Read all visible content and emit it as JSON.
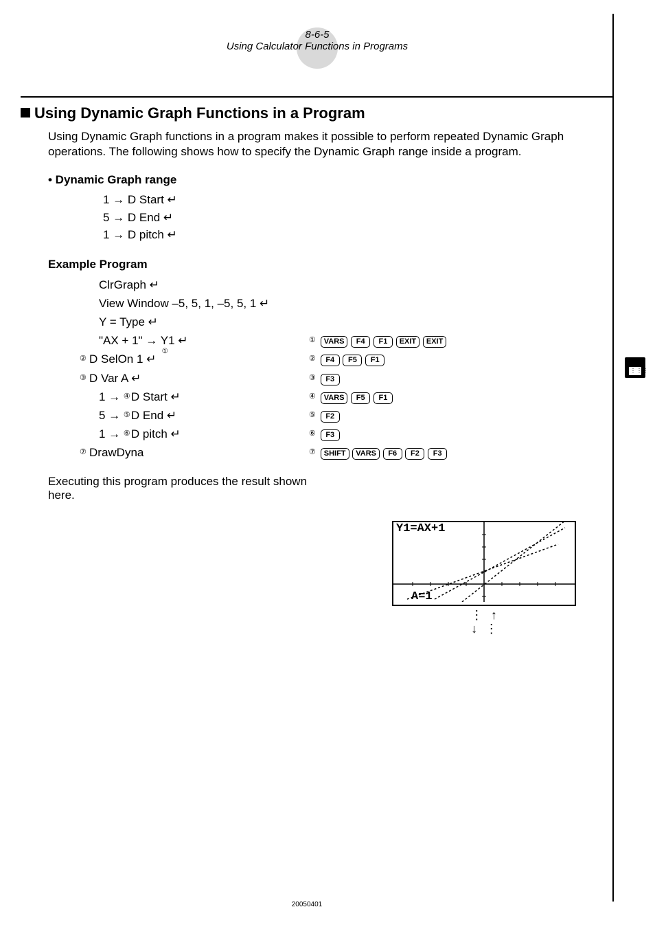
{
  "header": {
    "section": "8-6-5",
    "subtitle": "Using Calculator Functions in Programs"
  },
  "title": "Using Dynamic Graph Functions in a Program",
  "intro": "Using Dynamic Graph functions in a program makes it possible to perform repeated Dynamic Graph operations. The following shows how to specify the Dynamic Graph range inside a program.",
  "range_heading": "• Dynamic Graph range",
  "range_lines": [
    "1 → D  Start ↵",
    "5 → D  End ↵",
    "1 → D  pitch ↵"
  ],
  "example_heading": "Example Program",
  "example": {
    "l1": "ClrGraph ↵",
    "l2": "View Window  –5, 5, 1, –5, 5, 1 ↵",
    "l3": "Y = Type ↵",
    "l4": "\"AX + 1\" → Y1 ↵",
    "l5": "D SelOn 1 ↵",
    "l6": "D Var A ↵",
    "l7": "1 → ",
    "l7b": "D  Start ↵",
    "l8": "5 → ",
    "l8b": "D  End ↵",
    "l9": "1 → ",
    "l9b": "D  pitch ↵",
    "l10": "DrawDyna"
  },
  "circ": {
    "c1": "①",
    "c2": "②",
    "c3": "③",
    "c4": "④",
    "c5": "⑤",
    "c6": "⑥",
    "c7": "⑦"
  },
  "keys": {
    "VARS": "VARS",
    "F1": "F1",
    "F2": "F2",
    "F3": "F3",
    "F4": "F4",
    "F5": "F5",
    "F6": "F6",
    "EXIT": "EXIT",
    "SHIFT": "SHIFT"
  },
  "result_caption": "Executing this program produces the result shown here.",
  "screen": {
    "top": "Y1=AX+1",
    "bottom": "A=1"
  },
  "footer": "20050401"
}
